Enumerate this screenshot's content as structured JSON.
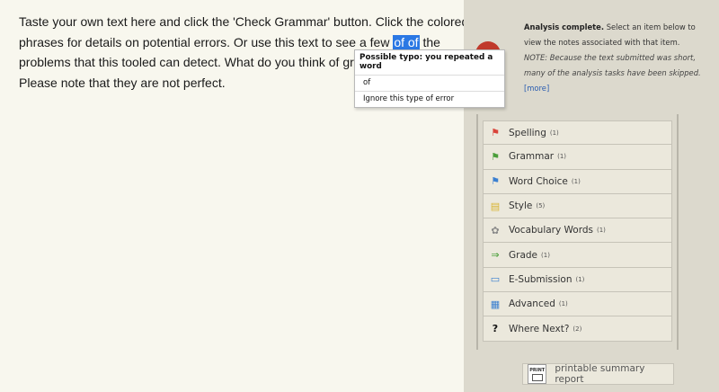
{
  "editor": {
    "line1": "Taste your own text here and click the 'Check Grammar' button. Click the colored",
    "line2_before": "phrases for details on potential errors. Or use this text to see a few ",
    "line2_highlight": "of of",
    "line2_after": " the",
    "line3": "problems that this tooled can detect. What do you think of grammar",
    "line4": "Please note that they are not perfect."
  },
  "popup": {
    "title": "Possible typo: you repeated a word",
    "items": [
      "of",
      "Ignore this type of error"
    ]
  },
  "analysis": {
    "bold": "Analysis complete.",
    "text": " Select an item below to view the notes associated with that item.",
    "note": "NOTE: Because the text submitted was short, many of the analysis tasks have been skipped.",
    "more": "[more]"
  },
  "categories": [
    {
      "label": "Spelling",
      "count": "(1)",
      "icon": "red-flag-icon",
      "glyph": "⚑",
      "color": "#d9443a"
    },
    {
      "label": "Grammar",
      "count": "(1)",
      "icon": "green-flag-icon",
      "glyph": "⚑",
      "color": "#4a9e3a"
    },
    {
      "label": "Word Choice",
      "count": "(1)",
      "icon": "blue-flag-icon",
      "glyph": "⚑",
      "color": "#3a7fd0"
    },
    {
      "label": "Style",
      "count": "(5)",
      "icon": "note-icon",
      "glyph": "▤",
      "color": "#d8b430"
    },
    {
      "label": "Vocabulary Words",
      "count": "(1)",
      "icon": "gear-icon",
      "glyph": "✿",
      "color": "#888888"
    },
    {
      "label": "Grade",
      "count": "(1)",
      "icon": "arrow-right-icon",
      "glyph": "⇒",
      "color": "#3e9a2e"
    },
    {
      "label": "E-Submission",
      "count": "(1)",
      "icon": "monitor-icon",
      "glyph": "▭",
      "color": "#3a7fd0"
    },
    {
      "label": "Advanced",
      "count": "(1)",
      "icon": "chart-icon",
      "glyph": "▦",
      "color": "#3a7fd0"
    },
    {
      "label": "Where Next?",
      "count": "(2)",
      "icon": "question-icon",
      "glyph": "?",
      "color": "#111111"
    }
  ],
  "print": {
    "icon_text": "PRINT",
    "label": "printable summary report"
  }
}
